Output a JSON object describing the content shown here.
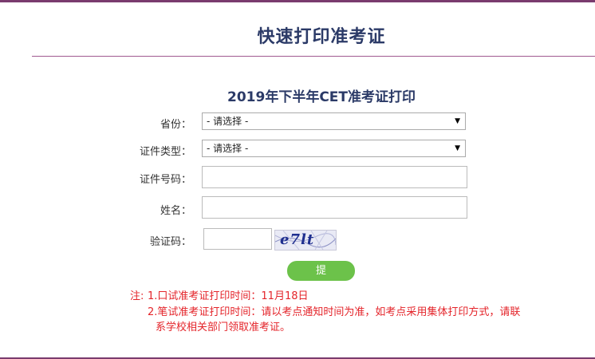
{
  "page": {
    "title": "快速打印准考证"
  },
  "form": {
    "title": "2019年下半年CET准考证打印",
    "province": {
      "label": "省份：",
      "value": "- 请选择 -"
    },
    "id_type": {
      "label": "证件类型：",
      "value": "- 请选择 -"
    },
    "id_number": {
      "label": "证件号码：",
      "value": ""
    },
    "name": {
      "label": "姓名：",
      "value": ""
    },
    "captcha": {
      "label": "验证码：",
      "value": "",
      "image_text": "e7lt"
    },
    "submit_label": "提 交"
  },
  "notes": {
    "prefix": "注:",
    "line1": "1.口试准考证打印时间：11月18日",
    "line2": "2.笔试准考证打印时间：请以考点通知时间为准，如考点采用集体打印方式，请联",
    "line3": "系学校相关部门领取准考证。"
  },
  "colors": {
    "accent": "#7a3b6e",
    "title": "#2b3a67",
    "button": "#6cc24a",
    "note": "#e4242a"
  },
  "icons": {
    "dropdown": "triangle-down"
  }
}
